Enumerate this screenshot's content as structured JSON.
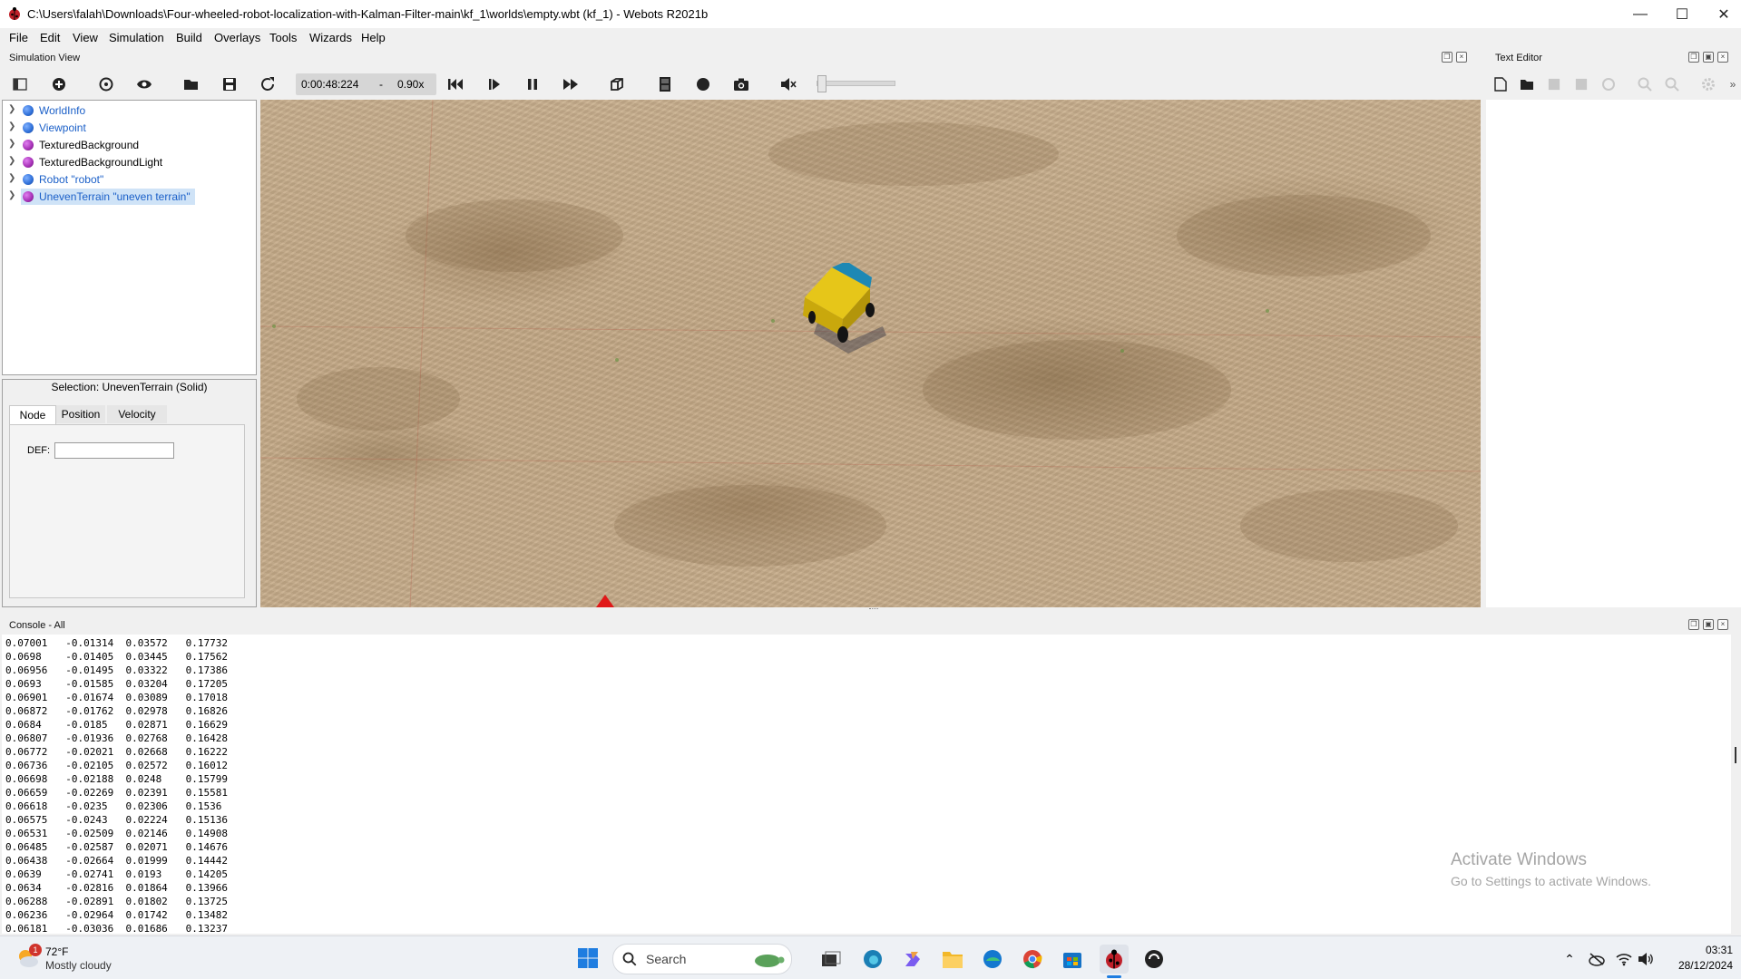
{
  "window": {
    "title": "C:\\Users\\falah\\Downloads\\Four-wheeled-robot-localization-with-Kalman-Filter-main\\kf_1\\worlds\\empty.wbt (kf_1) - Webots R2021b",
    "minimize": "—",
    "maximize": "☐",
    "close": "✕"
  },
  "menubar": [
    "File",
    "Edit",
    "View",
    "Simulation",
    "Build",
    "Overlays",
    "Tools",
    "Wizards",
    "Help"
  ],
  "simulation_view": {
    "title": "Simulation View",
    "time": "0:00:48:224",
    "time_sep": "-",
    "speed": "0.90x"
  },
  "text_editor": {
    "title": "Text Editor"
  },
  "scene_tree": [
    {
      "label": "WorldInfo",
      "color": "#2e6fd8",
      "text_color": "#1a5fc8"
    },
    {
      "label": "Viewpoint",
      "color": "#2e6fd8",
      "text_color": "#1a5fc8"
    },
    {
      "label": "TexturedBackground",
      "color": "#a52fb5",
      "text_color": "#000000"
    },
    {
      "label": "TexturedBackgroundLight",
      "color": "#a52fb5",
      "text_color": "#000000"
    },
    {
      "label": "Robot \"robot\"",
      "color": "#2e6fd8",
      "text_color": "#1a5fc8"
    },
    {
      "label": "UnevenTerrain \"uneven terrain\"",
      "color": "#a52fb5",
      "text_color": "#1a5fc8",
      "selected": true
    }
  ],
  "selection": {
    "title": "Selection: UnevenTerrain (Solid)",
    "tabs": [
      "Node",
      "Position",
      "Velocity"
    ],
    "def_label": "DEF:",
    "def_value": ""
  },
  "console": {
    "title": "Console - All",
    "rows": [
      [
        "0.07001",
        "-0.01314",
        "0.03572",
        "0.17732"
      ],
      [
        "0.0698",
        "-0.01405",
        "0.03445",
        "0.17562"
      ],
      [
        "0.06956",
        "-0.01495",
        "0.03322",
        "0.17386"
      ],
      [
        "0.0693",
        "-0.01585",
        "0.03204",
        "0.17205"
      ],
      [
        "0.06901",
        "-0.01674",
        "0.03089",
        "0.17018"
      ],
      [
        "0.06872",
        "-0.01762",
        "0.02978",
        "0.16826"
      ],
      [
        "0.0684",
        "-0.0185",
        "0.02871",
        "0.16629"
      ],
      [
        "0.06807",
        "-0.01936",
        "0.02768",
        "0.16428"
      ],
      [
        "0.06772",
        "-0.02021",
        "0.02668",
        "0.16222"
      ],
      [
        "0.06736",
        "-0.02105",
        "0.02572",
        "0.16012"
      ],
      [
        "0.06698",
        "-0.02188",
        "0.0248",
        "0.15799"
      ],
      [
        "0.06659",
        "-0.02269",
        "0.02391",
        "0.15581"
      ],
      [
        "0.06618",
        "-0.0235",
        "0.02306",
        "0.1536"
      ],
      [
        "0.06575",
        "-0.0243",
        "0.02224",
        "0.15136"
      ],
      [
        "0.06531",
        "-0.02509",
        "0.02146",
        "0.14908"
      ],
      [
        "0.06485",
        "-0.02587",
        "0.02071",
        "0.14676"
      ],
      [
        "0.06438",
        "-0.02664",
        "0.01999",
        "0.14442"
      ],
      [
        "0.0639",
        "-0.02741",
        "0.0193",
        "0.14205"
      ],
      [
        "0.0634",
        "-0.02816",
        "0.01864",
        "0.13966"
      ],
      [
        "0.06288",
        "-0.02891",
        "0.01802",
        "0.13725"
      ],
      [
        "0.06236",
        "-0.02964",
        "0.01742",
        "0.13482"
      ],
      [
        "0.06181",
        "-0.03036",
        "0.01686",
        "0.13237"
      ]
    ]
  },
  "watermark": {
    "line1": "Activate Windows",
    "line2": "Go to Settings to activate Windows."
  },
  "taskbar": {
    "weather_temp": "72°F",
    "weather_desc": "Mostly cloudy",
    "weather_badge": "1",
    "search_placeholder": "Search",
    "time": "03:31",
    "date": "28/12/2024"
  }
}
